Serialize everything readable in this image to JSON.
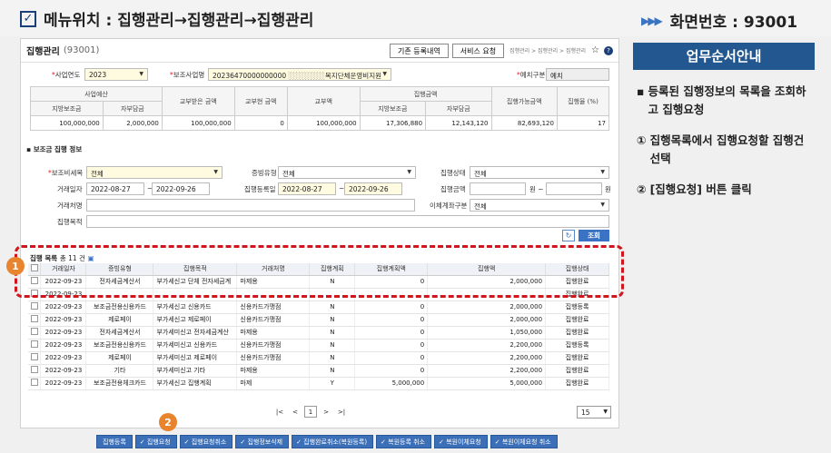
{
  "header": {
    "menu_label": "메뉴위치 : 집행관리→집행관리→집행관리",
    "screen_no": "화면번호 : 93001",
    "arrows": "▶▶▶"
  },
  "app": {
    "title": "집행관리",
    "code": "(93001)",
    "btn_prev": "기존 등록내역",
    "btn_service": "서비스 요청",
    "breadcrumb": "집행관리 > 집행관리 > 집행관리",
    "fields": {
      "year_label": "사업연도",
      "year_value": "2023",
      "biz_label": "보조사업명",
      "biz_code": "20236470000000000",
      "biz_name": "복지단체운영비지원",
      "account_label": "예치구분",
      "account_value": "예치"
    },
    "summary": {
      "h_budget": "사업예산",
      "h_local": "지방보조금",
      "h_self": "자부담금",
      "h_grant_recv": "교부받은 금액",
      "h_grant_fin": "교부현 금액",
      "h_grant_total": "교부액",
      "h_exec": "집행금액",
      "h_exec_local": "지방보조금",
      "h_exec_self": "자부담금",
      "h_avail": "집행가능금액",
      "h_rate": "집행율 (%)",
      "v_local": "100,000,000",
      "v_self": "2,000,000",
      "v_grant_recv": "100,000,000",
      "v_grant_fin": "0",
      "v_grant_total": "100,000,000",
      "v_exec_local": "17,306,880",
      "v_exec_self": "12,143,120",
      "v_avail": "82,693,120",
      "v_rate": "17"
    },
    "section_search": "보조금 집행 정보",
    "search": {
      "item_label": "보조비세목",
      "item_value": "전체",
      "proof_label": "증빙유형",
      "proof_value": "전체",
      "state_label": "집행상태",
      "state_value": "전체",
      "trade_date_label": "거래일자",
      "trade_from": "2022-08-27",
      "trade_to": "2022-09-26",
      "reg_date_label": "집행등록일",
      "reg_from": "2022-08-27",
      "reg_to": "2022-09-26",
      "amount_label": "집행금액",
      "unit_won": "원",
      "vendor_label": "거래처명",
      "transfer_label": "이체계좌구분",
      "transfer_value": "전체",
      "purpose_label": "집행목적",
      "search_btn": "조회",
      "reset_icon": "↻"
    },
    "list": {
      "title": "집행 목록",
      "count": "총 11 건",
      "columns": [
        "",
        "거래일자",
        "증빙유형",
        "집행목적",
        "거래처명",
        "집행계획",
        "집행계획액",
        "집행액",
        "집행상태"
      ],
      "rows": [
        [
          "2022-09-23",
          "전자세금계산서",
          "부가세신고 단체 전자세금계",
          "마제용",
          "N",
          "0",
          "2,000,000",
          "집행완료"
        ],
        [
          "2022-09-23",
          "",
          "",
          "",
          "",
          "",
          "",
          "집행완료"
        ],
        [
          "2022-09-23",
          "보조금전용신용카드",
          "부가세신고 신용카드",
          "신용카드가맹점",
          "N",
          "0",
          "2,000,000",
          "집행등록"
        ],
        [
          "2022-09-23",
          "제로페이",
          "부가세신고 제로페이",
          "신용카드가맹점",
          "N",
          "0",
          "2,000,000",
          "집행완료"
        ],
        [
          "2022-09-23",
          "전자세금계산서",
          "부가세미신고 전자세금계산",
          "마제용",
          "N",
          "0",
          "1,050,000",
          "집행완료"
        ],
        [
          "2022-09-23",
          "보조금전용신용카드",
          "부가세미신고 신용카드",
          "신용카드가맹점",
          "N",
          "0",
          "2,200,000",
          "집행등록"
        ],
        [
          "2022-09-23",
          "제로페이",
          "부가세미신고 제로페이",
          "신용카드가맹점",
          "N",
          "0",
          "2,200,000",
          "집행완료"
        ],
        [
          "2022-09-23",
          "기타",
          "부가세미신고 기타",
          "마제용",
          "N",
          "0",
          "2,200,000",
          "집행완료"
        ],
        [
          "2022-09-23",
          "보조금전용체크카드",
          "부가세신고 집행계획",
          "마제",
          "Y",
          "5,000,000",
          "5,000,000",
          "집행완료"
        ]
      ]
    },
    "pager": {
      "first": "|<",
      "prev": "<",
      "page": "1",
      "next": ">",
      "last": ">|",
      "size": "15"
    },
    "buttons": [
      "집행등록",
      "집행요청",
      "집행요청취소",
      "집행정보삭제",
      "집행완료취소(복원등록)",
      "복원등록 취소",
      "복원이체요청",
      "복원이체요청 취소"
    ],
    "badges": {
      "one": "1",
      "two": "2"
    }
  },
  "guide": {
    "title": "업무순서안내",
    "bullet": "등록된 집행정보의 목록을 조회하고 집행요청",
    "step1_no": "①",
    "step1": "집행목록에서 집행요청할 집행건 선택",
    "step2_no": "②",
    "step2": "[집행요청] 버튼 클릭"
  },
  "colors": {
    "accent": "#3b73c4",
    "guide_title": "#23578f",
    "badge": "#e8832e",
    "highlight": "#d0151c"
  }
}
